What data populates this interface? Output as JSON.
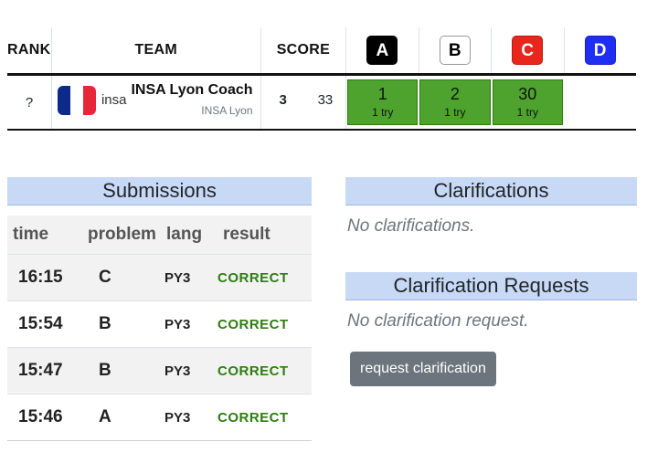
{
  "scoreboard": {
    "headers": {
      "rank": "RANK",
      "team": "TEAM",
      "score": "SCORE"
    },
    "problems": [
      {
        "label": "A",
        "bg": "#000000",
        "fg": "#ffffff",
        "border": "#000000"
      },
      {
        "label": "B",
        "bg": "#ffffff",
        "fg": "#000000",
        "border": "#999999"
      },
      {
        "label": "C",
        "bg": "#e8261c",
        "fg": "#ffffff",
        "border": "#b81a12"
      },
      {
        "label": "D",
        "bg": "#1f2ef2",
        "fg": "#ffffff",
        "border": "#1522c4"
      }
    ],
    "row": {
      "rank": "?",
      "affiliation_short": "insa",
      "team_name": "INSA Lyon Coach",
      "affiliation": "INSA Lyon",
      "flag_colors": [
        "#0d2a8a",
        "#ffffff",
        "#e8263a"
      ],
      "solved": "3",
      "penalty": "33",
      "results": [
        {
          "time": "1",
          "tries": "1 try"
        },
        {
          "time": "2",
          "tries": "1 try"
        },
        {
          "time": "30",
          "tries": "1 try"
        },
        null
      ]
    },
    "solved_color": "#4da32e"
  },
  "submissions": {
    "title": "Submissions",
    "columns": [
      "time",
      "problem",
      "lang",
      "result"
    ],
    "rows": [
      {
        "time": "16:15",
        "problem": "C",
        "lang": "PY3",
        "result": "CORRECT"
      },
      {
        "time": "15:54",
        "problem": "B",
        "lang": "PY3",
        "result": "CORRECT"
      },
      {
        "time": "15:47",
        "problem": "B",
        "lang": "PY3",
        "result": "CORRECT"
      },
      {
        "time": "15:46",
        "problem": "A",
        "lang": "PY3",
        "result": "CORRECT"
      }
    ]
  },
  "clarifications": {
    "title": "Clarifications",
    "empty_text": "No clarifications.",
    "requests_title": "Clarification Requests",
    "requests_empty_text": "No clarification request.",
    "request_button": "request clarification"
  }
}
